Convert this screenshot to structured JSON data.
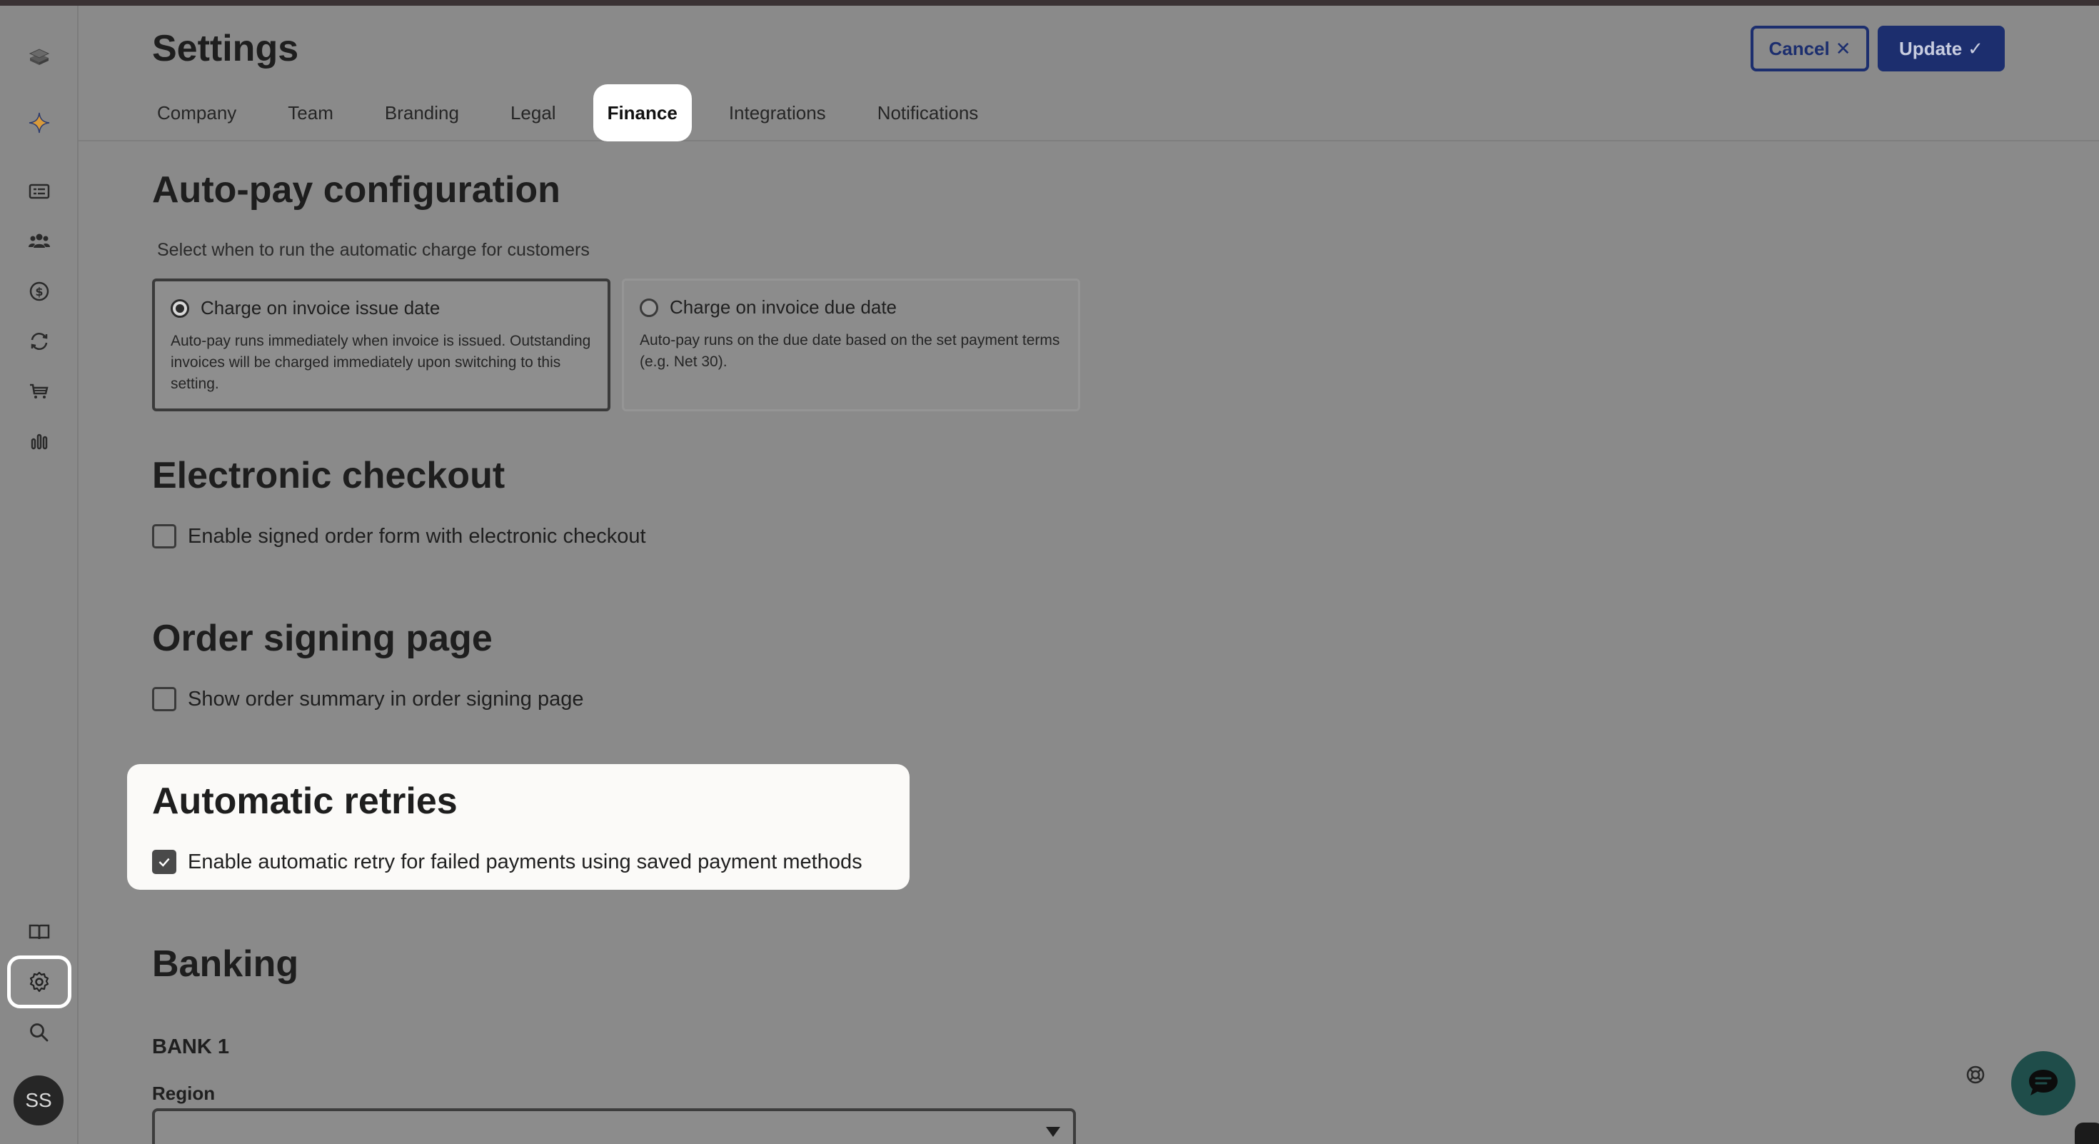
{
  "header": {
    "title": "Settings",
    "cancel_label": "Cancel",
    "cancel_icon": "close-icon",
    "update_label": "Update",
    "update_icon": "check-icon",
    "tabs": [
      {
        "label": "Company"
      },
      {
        "label": "Team"
      },
      {
        "label": "Branding"
      },
      {
        "label": "Legal"
      },
      {
        "label": "Finance",
        "active": true
      },
      {
        "label": "Integrations"
      },
      {
        "label": "Notifications"
      }
    ]
  },
  "sidebar": {
    "items": [
      {
        "icon": "logo-icon"
      },
      {
        "icon": "sparkle-icon"
      },
      {
        "icon": "quotes-icon"
      },
      {
        "icon": "customers-icon"
      },
      {
        "icon": "billing-icon"
      },
      {
        "icon": "subscriptions-icon"
      },
      {
        "icon": "catalog-icon"
      },
      {
        "icon": "reports-icon"
      },
      {
        "icon": "docs-icon"
      },
      {
        "icon": "settings-icon",
        "active": true
      },
      {
        "icon": "search-icon"
      }
    ],
    "avatar_initials": "SS"
  },
  "autopay": {
    "title": "Auto-pay configuration",
    "subtitle": "Select when to run the automatic charge for customers",
    "options": [
      {
        "label": "Charge on invoice issue date",
        "description": "Auto-pay runs immediately when invoice is issued. Outstanding invoices will be charged immediately upon switching to this setting.",
        "selected": true
      },
      {
        "label": "Charge on invoice due date",
        "description": "Auto-pay runs on the due date based on the set payment terms (e.g. Net 30).",
        "selected": false
      }
    ]
  },
  "electronic_checkout": {
    "title": "Electronic checkout",
    "checkbox_label": "Enable signed order form with electronic checkout",
    "checked": false
  },
  "order_signing": {
    "title": "Order signing page",
    "checkbox_label": "Show order summary in order signing page",
    "checked": false
  },
  "automatic_retries": {
    "title": "Automatic retries",
    "checkbox_label": "Enable automatic retry for failed payments using saved payment methods",
    "checked": true
  },
  "banking": {
    "title": "Banking",
    "bank_label": "BANK 1",
    "region_label": "Region",
    "region_value": ""
  },
  "colors": {
    "primary": "#1c2e6e",
    "highlight_bg": "#fbfaf8",
    "overlay": "#8a8a8a",
    "chat_button": "#1f4d4a"
  }
}
